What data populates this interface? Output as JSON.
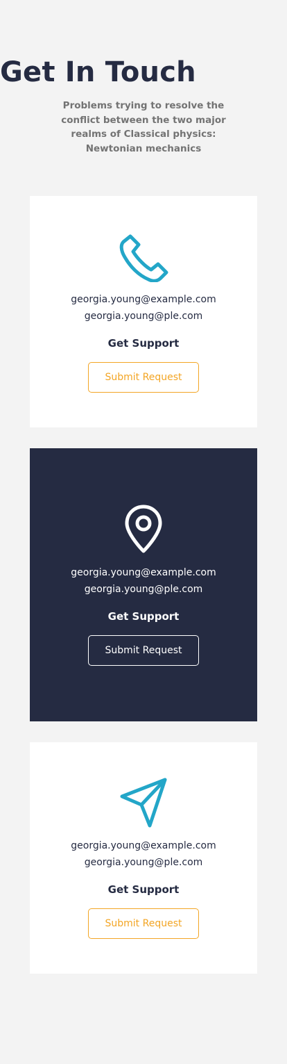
{
  "header": {
    "title": "Get In Touch",
    "subtitle": "Problems trying to resolve the conflict between the two major realms of Classical physics: Newtonian mechanics"
  },
  "colors": {
    "accent": "#23a6c8",
    "button_accent": "#f3a524",
    "dark": "#252b42",
    "muted": "#737373",
    "background": "#f3f3f3"
  },
  "cards": [
    {
      "icon": "phone-icon",
      "email_primary": "georgia.young@example.com",
      "email_secondary": "georgia.young@ple.com",
      "heading": "Get Support",
      "button_label": "Submit Request"
    },
    {
      "icon": "location-pin-icon",
      "email_primary": "georgia.young@example.com",
      "email_secondary": "georgia.young@ple.com",
      "heading": "Get Support",
      "button_label": "Submit Request"
    },
    {
      "icon": "send-icon",
      "email_primary": "georgia.young@example.com",
      "email_secondary": "georgia.young@ple.com",
      "heading": "Get Support",
      "button_label": "Submit Request"
    }
  ]
}
